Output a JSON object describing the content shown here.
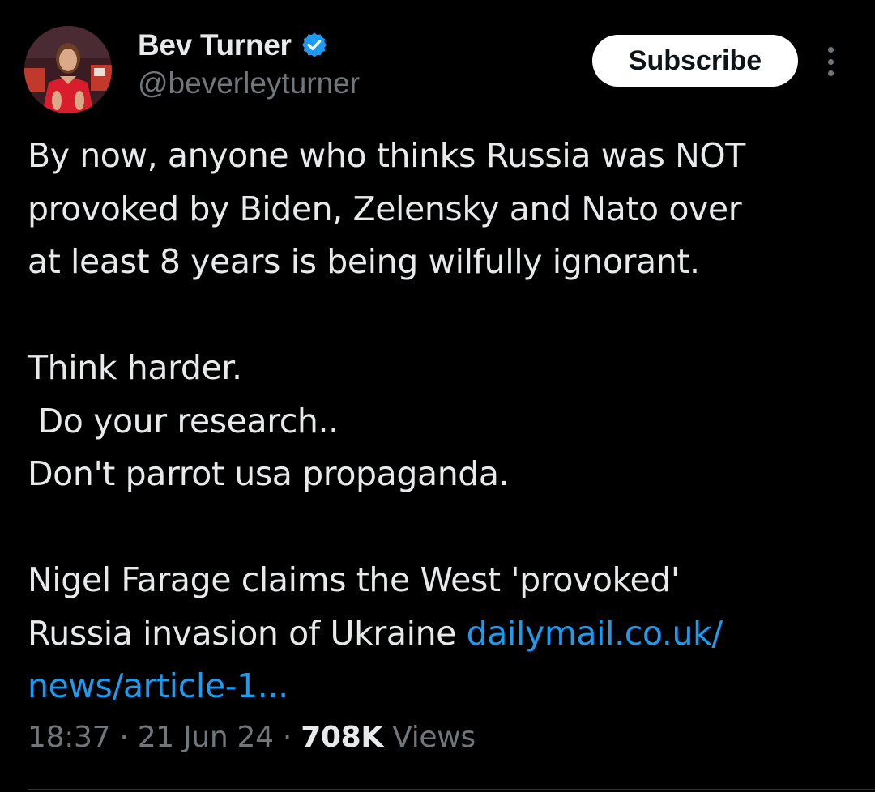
{
  "author": {
    "display_name": "Bev Turner",
    "handle": "@beverleyturner",
    "verified": true,
    "avatar_description": "avatar"
  },
  "actions": {
    "subscribe_label": "Subscribe",
    "more_icon": "more-vertical-icon"
  },
  "tweet": {
    "lines": [
      "By now, anyone who thinks Russia was NOT",
      "provoked by Biden, Zelensky and Nato over",
      "at least 8 years is being wilfully ignorant.",
      "",
      "Think harder.",
      " Do your research..",
      "Don't parrot usa propaganda.",
      "",
      "Nigel Farage claims the West 'provoked'"
    ],
    "link_lead_text": "Russia invasion of Ukraine ",
    "link_part_1": "dailymail.co.uk/",
    "link_part_2": "news/article-1..."
  },
  "meta": {
    "time": "18:37",
    "separator": " · ",
    "date": "21 Jun 24",
    "views_count": "708K",
    "views_label": " Views"
  },
  "colors": {
    "background": "#000000",
    "text": "#e7e9ea",
    "secondary": "#71767b",
    "link": "#1d9bf0",
    "verified": "#1d9bf0",
    "subscribe_bg": "#ffffff"
  }
}
